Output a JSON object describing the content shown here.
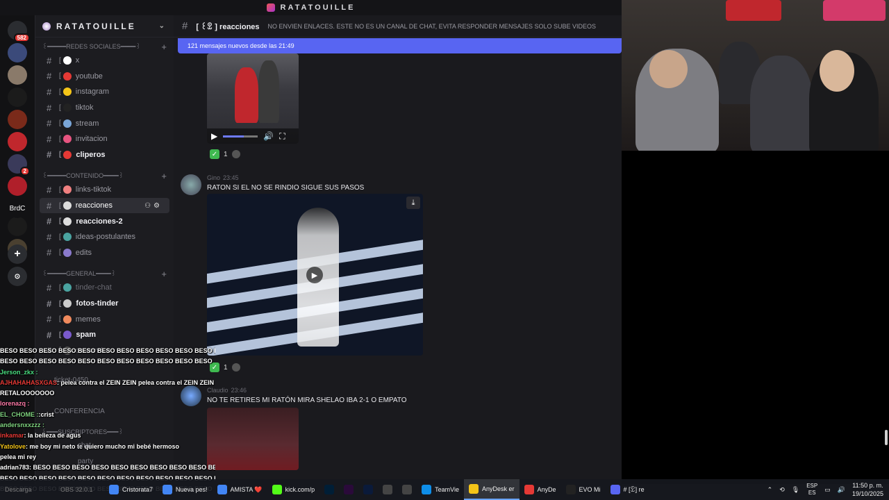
{
  "window": {
    "title": "RATATOUILLE"
  },
  "rail": {
    "servers": [
      {
        "icon": "discord-home-icon",
        "badge": "582",
        "color": "#2b2d31"
      },
      {
        "icon": "server-icon",
        "badge": "",
        "color": "#3b4a7a"
      },
      {
        "icon": "server-icon",
        "badge": "",
        "color": "#8a7a6a"
      },
      {
        "icon": "kick-icon",
        "badge": "",
        "color": "#1b1b1b"
      },
      {
        "icon": "server-icon",
        "badge": "",
        "color": "#7a2a1a"
      },
      {
        "icon": "server-icon",
        "badge": "",
        "color": "#c0272d"
      },
      {
        "icon": "server-icon",
        "badge": "2",
        "color": "#3a3a5a"
      },
      {
        "icon": "server-icon",
        "badge": "",
        "color": "#b01f2a"
      },
      {
        "icon": "server-icon",
        "badge": "",
        "color": "#1b1b1b"
      },
      {
        "icon": "server-icon",
        "badge": "",
        "color": "#4a4030"
      }
    ],
    "brdc_label": "BrdC"
  },
  "sidebar": {
    "server_name": "RATATOUILLE",
    "categories": {
      "redes": "꒰━━━━━REDES SOCIALES━━━━꒱",
      "contenido": "꒰━━━━━CONTENIDO━━━━꒱",
      "general": "꒰━━━━━GENERAL━━━━꒱",
      "suscriptores": "꒰━━━SUSCRIPTORES━━━꒱"
    },
    "channels": [
      {
        "name": "x",
        "emoji": "#ffffff"
      },
      {
        "name": "youtube",
        "emoji": "#e53935"
      },
      {
        "name": "instagram",
        "emoji": "#f5c518"
      },
      {
        "name": "tiktok",
        "emoji": "#222222"
      },
      {
        "name": "stream",
        "emoji": "#7aa6d8"
      },
      {
        "name": "invitacion",
        "emoji": "#e75480"
      },
      {
        "name": "cliperos",
        "emoji": "#e53935"
      },
      {
        "name": "links-tiktok",
        "emoji": "#f08080"
      },
      {
        "name": "reacciones",
        "emoji": "#dddddd"
      },
      {
        "name": "reacciones-2",
        "emoji": "#dddddd"
      },
      {
        "name": "ideas-postulantes",
        "emoji": "#4aa3a0"
      },
      {
        "name": "edits",
        "emoji": "#8a7acc"
      },
      {
        "name": "tinder-chat",
        "emoji": "#4aa3a0"
      },
      {
        "name": "fotos-tinder",
        "emoji": "#cccccc"
      },
      {
        "name": "memes",
        "emoji": "#f08a5d"
      },
      {
        "name": "spam",
        "emoji": "#7a5acc"
      },
      {
        "name": "comandos",
        "emoji": "#555555"
      },
      {
        "name": "ticket-0450",
        "emoji": "#555555"
      },
      {
        "name": "CONFERENCIA",
        "emoji": "#555555"
      },
      {
        "name": "party",
        "emoji": "#7aa6d8"
      },
      {
        "name": "chat",
        "emoji": "#7aa6d8"
      }
    ]
  },
  "header": {
    "channel": "reacciones",
    "channel_prefix": "[ ꒰ꀾ ]",
    "topic": "NO ENVIEN ENLACES. ESTE NO ES UN CANAL DE CHAT, EVITA RESPONDER MENSAJES SOLO SUBE VIDEOS"
  },
  "new_messages_bar": "121 mensajes nuevos desde las 21:49",
  "messages": [
    {
      "user": "Gino",
      "user_color": "#6a6a72",
      "time": "23:45",
      "text": "RATON SI EL NO SE RINDIO SIGUE SUS PASOS",
      "reaction_count": "1"
    },
    {
      "user": "Claudio",
      "user_color": "#6a6a72",
      "time": "23:46",
      "text": "NO TE RETIRES MI RATÓN MIRA SHELAO IBA 2-1 O EMPATO",
      "reaction_count": ""
    }
  ],
  "first_reaction_count": "1",
  "second_reaction_count": "1",
  "stream_chat": [
    {
      "user": "",
      "color": "#ffffff",
      "text": "BESO BESO BESO BESO BESO BESO BESO BESO BESO BESO BESO BESO"
    },
    {
      "user": "",
      "color": "#ffffff",
      "text": "BESO BESO BESO BESO BESO BESO BESO BESO BESO BESO BESO"
    },
    {
      "user": "Jerson_zkx :",
      "color": "#4ade80",
      "text": ""
    },
    {
      "user": "AJHAHAHASXGAS",
      "color": "#e53935",
      "text": ": pelea contra el ZEIN ZEIN pelea contra el ZEIN ZEIN"
    },
    {
      "user": "RETALOOOOOOO",
      "color": "#ffffff",
      "text": ""
    },
    {
      "user": "lorenazq :",
      "color": "#ff7aa8",
      "text": ""
    },
    {
      "user": "EL_CHOME :",
      "color": "#7fd37f",
      "text": ":crist"
    },
    {
      "user": "andersnxxzzz :",
      "color": "#7fd37f",
      "text": ""
    },
    {
      "user": "inkamar",
      "color": "#e53935",
      "text": ": la belleza de agus"
    },
    {
      "user": "Yatolove",
      "color": "#f5c518",
      "text": ": me boy mi neto te quiero mucho mi bebé hermoso"
    },
    {
      "user": "",
      "color": "#ffffff",
      "text": "pelea mi rey"
    },
    {
      "user": "adrian783",
      "color": "#ffffff",
      "text": ": BESO BESO BESO BESO BESO BESO BESO BESO BESO BESO"
    },
    {
      "user": "",
      "color": "#ffffff",
      "text": "BESO BESO BESO BESO BESO BESO BESO BESO BESO BESO BESO BESO"
    },
    {
      "user": "",
      "color": "#ffffff",
      "text": "BESO BESO BESO BESO BESO BESO BESO BESO BESO BESO BESO"
    }
  ],
  "taskbar": {
    "items": [
      {
        "label": "Cristorata7",
        "icon": "chrome-icon",
        "color": "#4285f4"
      },
      {
        "label": "Nueva pes!",
        "icon": "chrome-icon",
        "color": "#4285f4"
      },
      {
        "label": "AMISTA ❤️",
        "icon": "chrome-icon",
        "color": "#4285f4"
      },
      {
        "label": "kick.com/p",
        "icon": "kick-icon",
        "color": "#53fc18"
      },
      {
        "label": "",
        "icon": "photoshop-icon",
        "color": "#001e36"
      },
      {
        "label": "",
        "icon": "premiere-icon",
        "color": "#2a0a3a"
      },
      {
        "label": "",
        "icon": "lightroom-icon",
        "color": "#0a1a3a"
      },
      {
        "label": "",
        "icon": "app-icon",
        "color": "#444"
      },
      {
        "label": "",
        "icon": "app-icon",
        "color": "#444"
      },
      {
        "label": "TeamVie",
        "icon": "teamviewer-icon",
        "color": "#0e8ee9"
      },
      {
        "label": "AnyDesk er",
        "icon": "shield-icon",
        "color": "#f5c518"
      },
      {
        "label": "AnyDe",
        "icon": "anydesk-icon",
        "color": "#e53935"
      },
      {
        "label": "EVO Mi",
        "icon": "evo-icon",
        "color": "#222"
      },
      {
        "label": "# [ꀾ] re",
        "icon": "discord-icon",
        "color": "#5865f2"
      }
    ],
    "ghost_items": [
      "Descarga",
      "OBS 32.0.1"
    ],
    "lang_top": "ESP",
    "lang_bottom": "ES",
    "time": "11:50 p. m.",
    "date": "19/10/2025"
  }
}
